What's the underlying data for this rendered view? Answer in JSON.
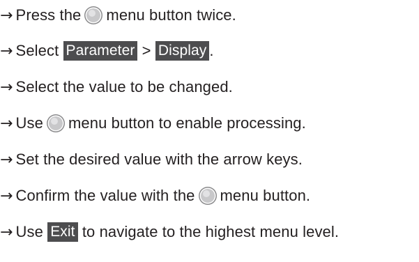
{
  "arrow_glyph": "→",
  "menu_button_icon": "menu-button-icon",
  "steps": [
    {
      "parts": [
        {
          "t": "Press the"
        },
        {
          "icon": "menu-button-icon"
        },
        {
          "t": "menu button twice."
        }
      ]
    },
    {
      "parts": [
        {
          "t": "Select "
        },
        {
          "kbd": "Parameter"
        },
        {
          "t": " > "
        },
        {
          "kbd": "Display"
        },
        {
          "t": "."
        }
      ]
    },
    {
      "parts": [
        {
          "t": "Select the value to be changed."
        }
      ]
    },
    {
      "parts": [
        {
          "t": "Use"
        },
        {
          "icon": "menu-button-icon"
        },
        {
          "t": "menu button to enable processing."
        }
      ]
    },
    {
      "parts": [
        {
          "t": "Set the desired value with the arrow keys."
        }
      ]
    },
    {
      "parts": [
        {
          "t": "Confirm the value with the"
        },
        {
          "icon": "menu-button-icon"
        },
        {
          "t": "menu button."
        }
      ]
    },
    {
      "parts": [
        {
          "t": "Use "
        },
        {
          "kbd": "Exit"
        },
        {
          "t": " to navigate to the highest menu level."
        }
      ]
    }
  ],
  "colors": {
    "text": "#231f20",
    "key_bg": "#4d4d4f",
    "key_fg": "#ffffff",
    "icon_outer": "#8a8a8c",
    "icon_inner": "#c8c8ca"
  }
}
